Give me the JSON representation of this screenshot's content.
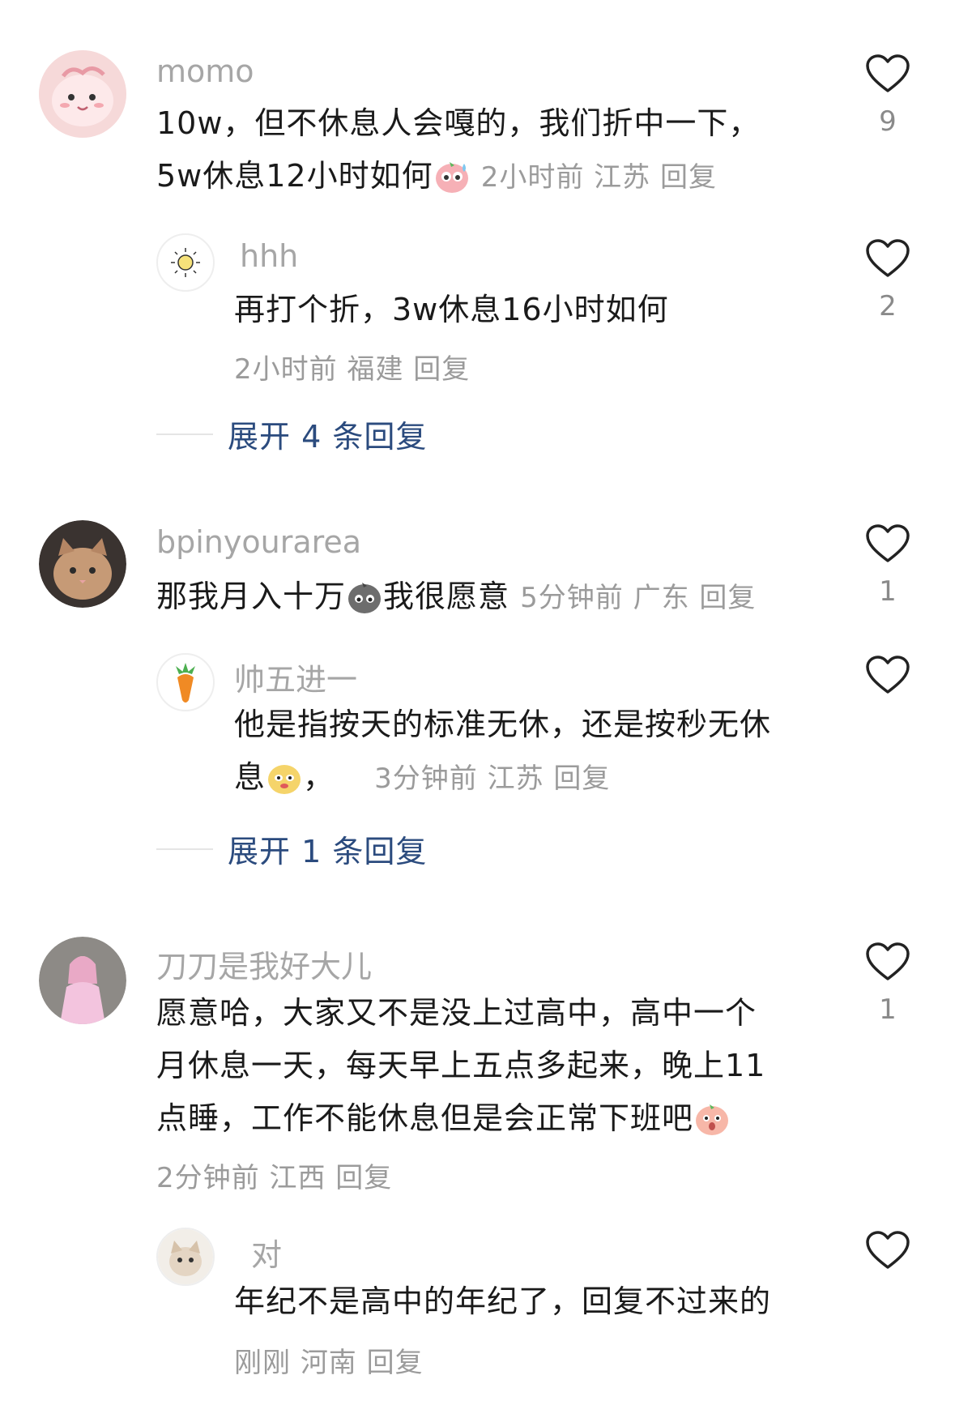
{
  "colors": {
    "username": "#a6a6a6",
    "body": "#1a1a1a",
    "meta": "#9b9b9b",
    "expand": "#2b4b7e",
    "heart": "#222222"
  },
  "comments": [
    {
      "username": "momo",
      "text_line1": "10w，但不休息人会嘎的，我们折中一下，",
      "text_line2": "5w休息12小时如何",
      "emoji": "sweat-face-emoji",
      "time": "2小时前",
      "location": "江苏",
      "reply": "回复",
      "likes": "9",
      "reply_item": {
        "username": "hhh",
        "text": "再打个折，3w休息16小时如何",
        "time": "2小时前",
        "location": "福建",
        "reply": "回复",
        "likes": "2"
      },
      "expand_label": "展开 4 条回复"
    },
    {
      "username": "bpinyourarea",
      "text": "那我月入十万",
      "text_after_emoji": "我很愿意",
      "emoji": "gray-blob-emoji",
      "time": "5分钟前",
      "location": "广东",
      "reply": "回复",
      "likes": "1",
      "reply_item": {
        "username": "帅五进一",
        "text_line1": "他是指按天的标准无休，还是按秒无休",
        "text_line2_a": "息",
        "text_line2_b": "，",
        "emoji": "yellow-face-emoji",
        "time": "3分钟前",
        "location": "江苏",
        "reply": "回复",
        "likes": ""
      },
      "expand_label": "展开 1 条回复"
    },
    {
      "username": "刀刀是我好大儿",
      "text_line1": "愿意哈，大家又不是没上过高中，高中一个",
      "text_line2": "月休息一天，每天早上五点多起来，晚上11",
      "text_line3": "点睡，工作不能休息但是会正常下班吧",
      "emoji": "shy-face-emoji",
      "time": "2分钟前",
      "location": "江西",
      "reply": "回复",
      "likes": "1",
      "reply_item": {
        "username": "对",
        "text": "年纪不是高中的年纪了，回复不过来的",
        "time": "刚刚",
        "location": "河南",
        "reply": "回复",
        "likes": ""
      }
    }
  ]
}
